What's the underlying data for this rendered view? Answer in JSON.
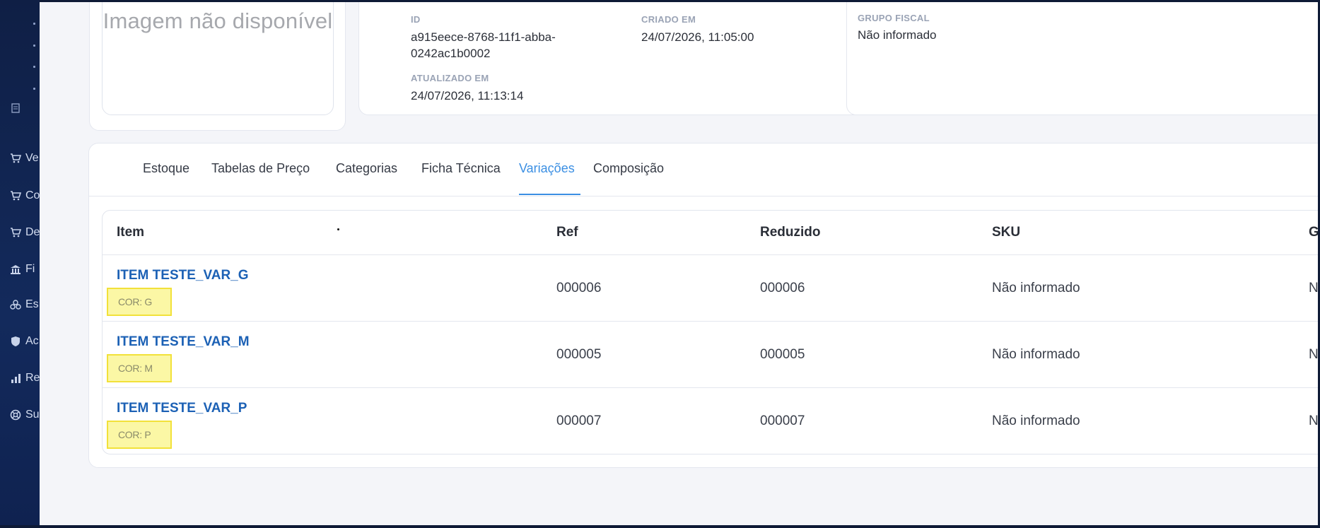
{
  "image_card": {
    "placeholder_text": "Imagem não disponível"
  },
  "info": {
    "id_label": "ID",
    "id_value_line1": "a915eece-8768-11f1-abba-",
    "id_value_line2": "0242ac1b0002",
    "created_label": "CRIADO EM",
    "created_value": "24/07/2026, 11:05:00",
    "updated_label": "ATUALIZADO EM",
    "updated_value": "24/07/2026, 11:13:14"
  },
  "fiscal": {
    "label": "GRUPO FISCAL",
    "value": "Não informado"
  },
  "sidebar": {
    "items": [
      {
        "label": "Ve",
        "icon": "cart-icon"
      },
      {
        "label": "Co",
        "icon": "cart-icon"
      },
      {
        "label": "De",
        "icon": "cart-icon"
      },
      {
        "label": "Fi",
        "icon": "bank-icon"
      },
      {
        "label": "Es",
        "icon": "boxes-icon"
      },
      {
        "label": "Ac",
        "icon": "shield-icon"
      },
      {
        "label": "Re",
        "icon": "bar-chart-icon"
      },
      {
        "label": "Su",
        "icon": "lifebuoy-icon"
      }
    ]
  },
  "tabs": [
    {
      "label": "Estoque"
    },
    {
      "label": "Tabelas de Preço"
    },
    {
      "label": "Categorias"
    },
    {
      "label": "Ficha Técnica"
    },
    {
      "label": "Variações",
      "active": true
    },
    {
      "label": "Composição"
    }
  ],
  "table": {
    "headers": {
      "item": "Item",
      "ref": "Ref",
      "reduzido": "Reduzido",
      "sku": "SKU",
      "next": "G"
    },
    "rows": [
      {
        "name": "ITEM TESTE_VAR_G",
        "attr": "COR: G",
        "ref": "000006",
        "reduzido": "000006",
        "sku": "Não informado",
        "next": "N"
      },
      {
        "name": "ITEM TESTE_VAR_M",
        "attr": "COR: M",
        "ref": "000005",
        "reduzido": "000005",
        "sku": "Não informado",
        "next": "N"
      },
      {
        "name": "ITEM TESTE_VAR_P",
        "attr": "COR: P",
        "ref": "000007",
        "reduzido": "000007",
        "sku": "Não informado",
        "next": "N"
      }
    ]
  },
  "colors": {
    "accent": "#3b8fe3",
    "link": "#1c61b5",
    "highlight": "#fbf7a5",
    "sidebar": "#132a5c"
  }
}
